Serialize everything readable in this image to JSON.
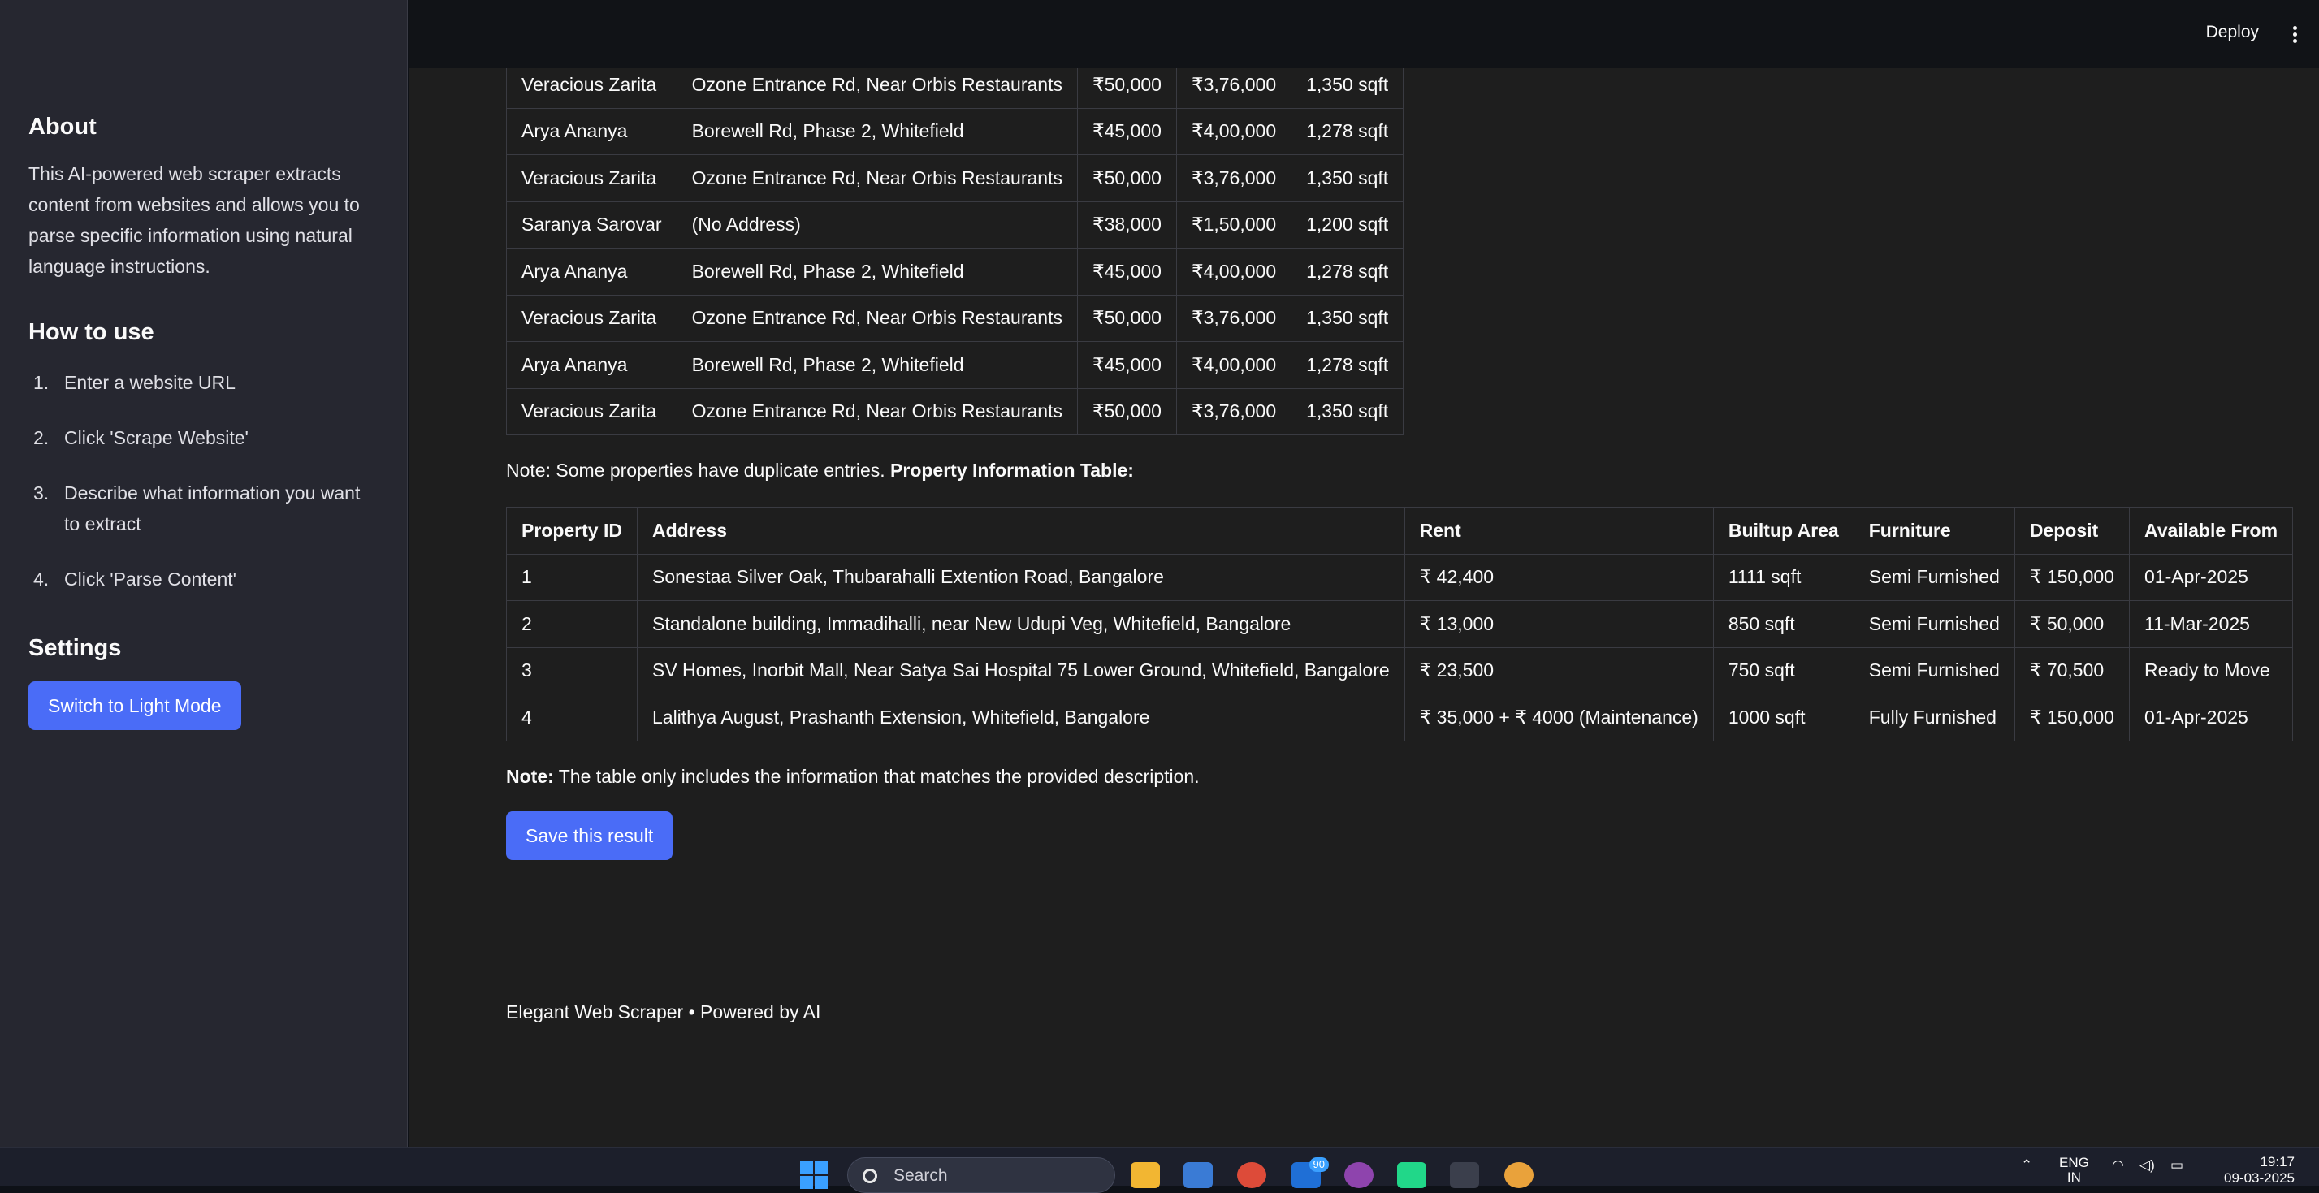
{
  "sidebar": {
    "about_title": "About",
    "about_text": "This AI-powered web scraper extracts content from websites and allows you to parse specific information using natural language instructions.",
    "howto_title": "How to use",
    "steps": [
      {
        "num": "1.",
        "text": "Enter a website URL"
      },
      {
        "num": "2.",
        "text": "Click 'Scrape Website'"
      },
      {
        "num": "3.",
        "text": "Describe what information you want to extract"
      },
      {
        "num": "4.",
        "text": "Click 'Parse Content'"
      }
    ],
    "settings_title": "Settings",
    "theme_button": "Switch to Light Mode"
  },
  "header": {
    "deploy_label": "Deploy",
    "menu_icon": "kebab-menu-icon"
  },
  "first_table": {
    "rows": [
      [
        "Veracious Zarita",
        "Ozone Entrance Rd, Near Orbis Restaurants",
        "₹50,000",
        "₹3,76,000",
        "1,350 sqft"
      ],
      [
        "Arya Ananya",
        "Borewell Rd, Phase 2, Whitefield",
        "₹45,000",
        "₹4,00,000",
        "1,278 sqft"
      ],
      [
        "Veracious Zarita",
        "Ozone Entrance Rd, Near Orbis Restaurants",
        "₹50,000",
        "₹3,76,000",
        "1,350 sqft"
      ],
      [
        "Saranya Sarovar",
        "(No Address)",
        "₹38,000",
        "₹1,50,000",
        "1,200 sqft"
      ],
      [
        "Arya Ananya",
        "Borewell Rd, Phase 2, Whitefield",
        "₹45,000",
        "₹4,00,000",
        "1,278 sqft"
      ],
      [
        "Veracious Zarita",
        "Ozone Entrance Rd, Near Orbis Restaurants",
        "₹50,000",
        "₹3,76,000",
        "1,350 sqft"
      ],
      [
        "Arya Ananya",
        "Borewell Rd, Phase 2, Whitefield",
        "₹45,000",
        "₹4,00,000",
        "1,278 sqft"
      ],
      [
        "Veracious Zarita",
        "Ozone Entrance Rd, Near Orbis Restaurants",
        "₹50,000",
        "₹3,76,000",
        "1,350 sqft"
      ]
    ]
  },
  "note1": {
    "text": "Note: Some properties have duplicate entries. ",
    "bold": "Property Information Table:"
  },
  "property_table": {
    "headers": [
      "Property ID",
      "Address",
      "Rent",
      "Builtup Area",
      "Furniture",
      "Deposit",
      "Available From"
    ],
    "rows": [
      [
        "1",
        "Sonestaa Silver Oak, Thubarahalli Extention Road, Bangalore",
        "₹ 42,400",
        "1111 sqft",
        "Semi Furnished",
        "₹ 150,000",
        "01-Apr-2025"
      ],
      [
        "2",
        "Standalone building, Immadihalli, near New Udupi Veg, Whitefield, Bangalore",
        "₹ 13,000",
        "850 sqft",
        "Semi Furnished",
        "₹ 50,000",
        "11-Mar-2025"
      ],
      [
        "3",
        "SV Homes, Inorbit Mall, Near Satya Sai Hospital 75 Lower Ground, Whitefield, Bangalore",
        "₹ 23,500",
        "750 sqft",
        "Semi Furnished",
        "₹ 70,500",
        "Ready to Move"
      ],
      [
        "4",
        "Lalithya August, Prashanth Extension, Whitefield, Bangalore",
        "₹ 35,000 + ₹ 4000 (Maintenance)",
        "1000 sqft",
        "Fully Furnished",
        "₹ 150,000",
        "01-Apr-2025"
      ]
    ]
  },
  "note2": {
    "bold": "Note:",
    "text": " The table only includes the information that matches the provided description."
  },
  "save_button": "Save this result",
  "footer": "Elegant Web Scraper • Powered by AI",
  "taskbar": {
    "search_label": "Search",
    "badge_count": "90",
    "lang_top": "ENG",
    "lang_bottom": "IN",
    "time": "19:17",
    "date": "09-03-2025"
  }
}
